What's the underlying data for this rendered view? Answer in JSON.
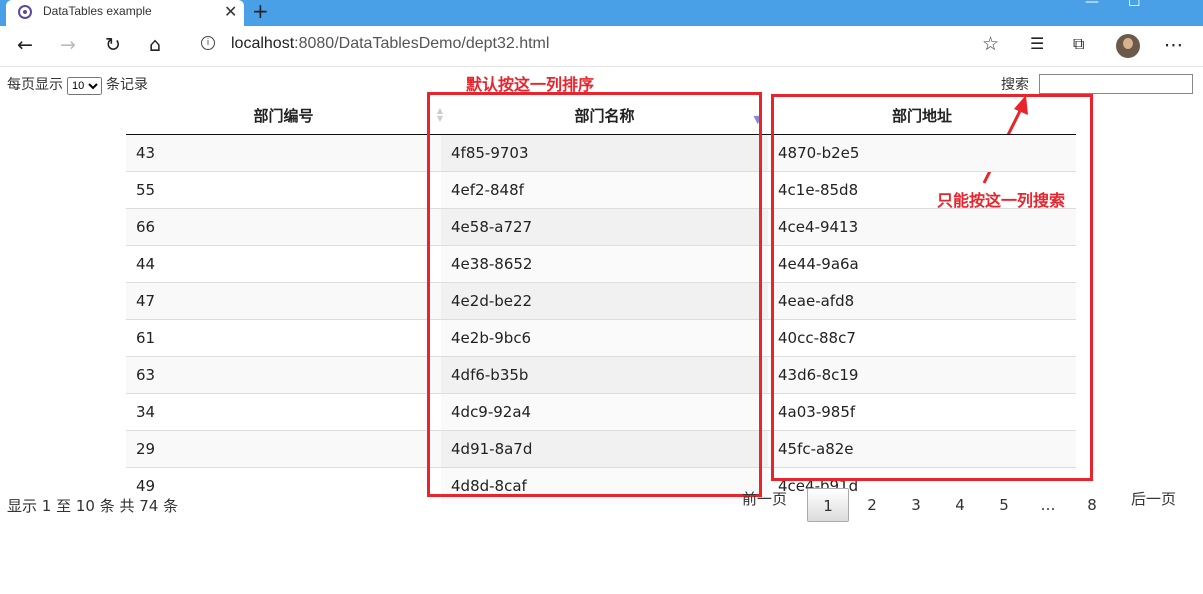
{
  "browser": {
    "tab_title": "DataTables example",
    "tab_close": "✕",
    "new_tab": "+",
    "url_host": "localhost",
    "url_path": ":8080/DataTablesDemo/dept32.html",
    "minimize": "—",
    "maximize": "☐"
  },
  "controls": {
    "length_prefix": "每页显示",
    "length_value": "10",
    "length_suffix": "条记录",
    "search_label": "搜索"
  },
  "annotations": {
    "sort_note": "默认按这一列排序",
    "search_note": "只能按这一列搜索"
  },
  "table": {
    "headers": [
      "部门编号",
      "部门名称",
      "部门地址"
    ],
    "rows": [
      [
        "43",
        "4f85-9703",
        "4870-b2e5"
      ],
      [
        "55",
        "4ef2-848f",
        "4c1e-85d8"
      ],
      [
        "66",
        "4e58-a727",
        "4ce4-9413"
      ],
      [
        "44",
        "4e38-8652",
        "4e44-9a6a"
      ],
      [
        "47",
        "4e2d-be22",
        "4eae-afd8"
      ],
      [
        "61",
        "4e2b-9bc6",
        "40cc-88c7"
      ],
      [
        "63",
        "4df6-b35b",
        "43d6-8c19"
      ],
      [
        "34",
        "4dc9-92a4",
        "4a03-985f"
      ],
      [
        "29",
        "4d91-8a7d",
        "45fc-a82e"
      ],
      [
        "49",
        "4d8d-8caf",
        "4ce4-b91d"
      ]
    ]
  },
  "info": "显示 1 至 10 条  共 74 条",
  "pagination": {
    "previous": "前一页",
    "pages": [
      "1",
      "2",
      "3",
      "4",
      "5",
      "…",
      "8"
    ],
    "current": "1",
    "next": "后一页"
  },
  "colors": {
    "annotation_red": "#e8242c",
    "titlebar_blue": "#4aa0e6"
  }
}
